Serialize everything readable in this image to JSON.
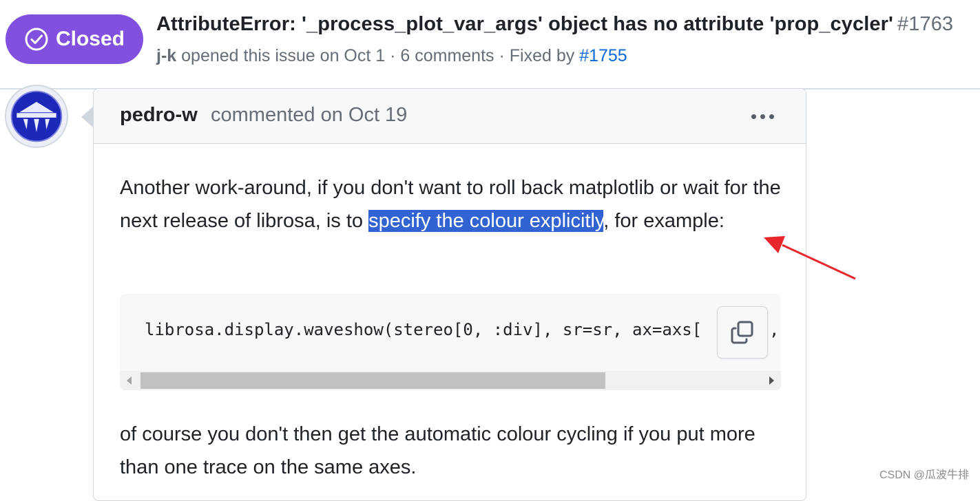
{
  "issue": {
    "state": "Closed",
    "title": "AttributeError: '_process_plot_var_args' object has no attribute 'prop_cycler'",
    "number": "#1763",
    "author": "j-k",
    "opened_text": " opened this issue on Oct 1 · 6 comments · Fixed by ",
    "fixed_by": "#1755"
  },
  "comment": {
    "author": "pedro-w",
    "meta": "commented on Oct 19",
    "paragraph1_before": "Another work-around, if you don't want to roll back matplotlib or wait for the next release of librosa, is to ",
    "paragraph1_highlight": "specify the colour explicitly",
    "paragraph1_after": ", for example:",
    "code": "librosa.display.waveshow(stereo[0, :div], sr=sr, ax=axs[",
    "code_trailing": ",",
    "paragraph2": "of course you don't then get the automatic colour cycling if you put more than one trace on the same axes.",
    "code_scroll_visible_fraction": 0.75
  },
  "watermark": "CSDN @瓜波牛排",
  "colors": {
    "closed_badge": "#8250df",
    "link": "#0969da",
    "highlight": "#3163d2",
    "annotation_arrow": "#e8262c"
  }
}
